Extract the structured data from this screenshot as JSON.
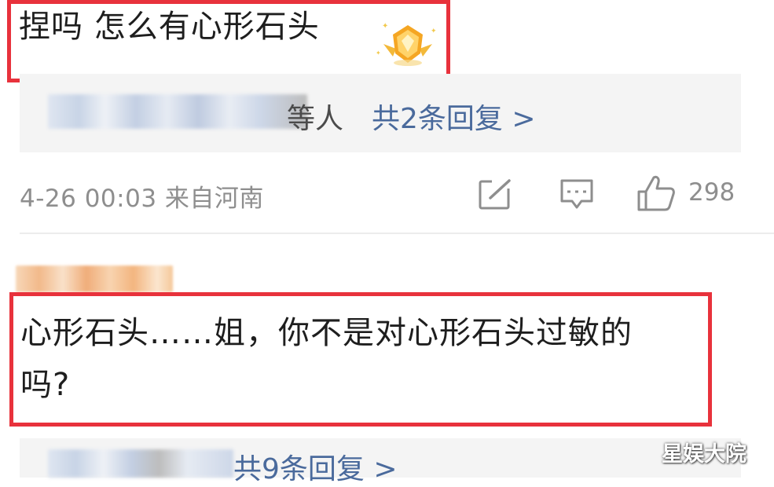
{
  "comment1": {
    "text": "捏吗 怎么有心形石头",
    "reply_suffix": "等人",
    "reply_link": "共2条回复 >",
    "time_location": "4-26 00:03 来自河南",
    "like_count": "298",
    "badge_icon": "medal-badge-icon"
  },
  "comment2": {
    "line1": "心形石头……姐，你不是对心形石头过敏的",
    "line2": "吗?",
    "reply_link": "共9条回复 >"
  },
  "watermark": "星娱大院",
  "colors": {
    "highlight_border": "#e8323c",
    "link": "#4a6a9c",
    "meta": "#8e8e8e",
    "panel_bg": "#f4f4f4"
  },
  "icons": [
    "edit-icon",
    "comment-icon",
    "thumbs-up-icon"
  ]
}
